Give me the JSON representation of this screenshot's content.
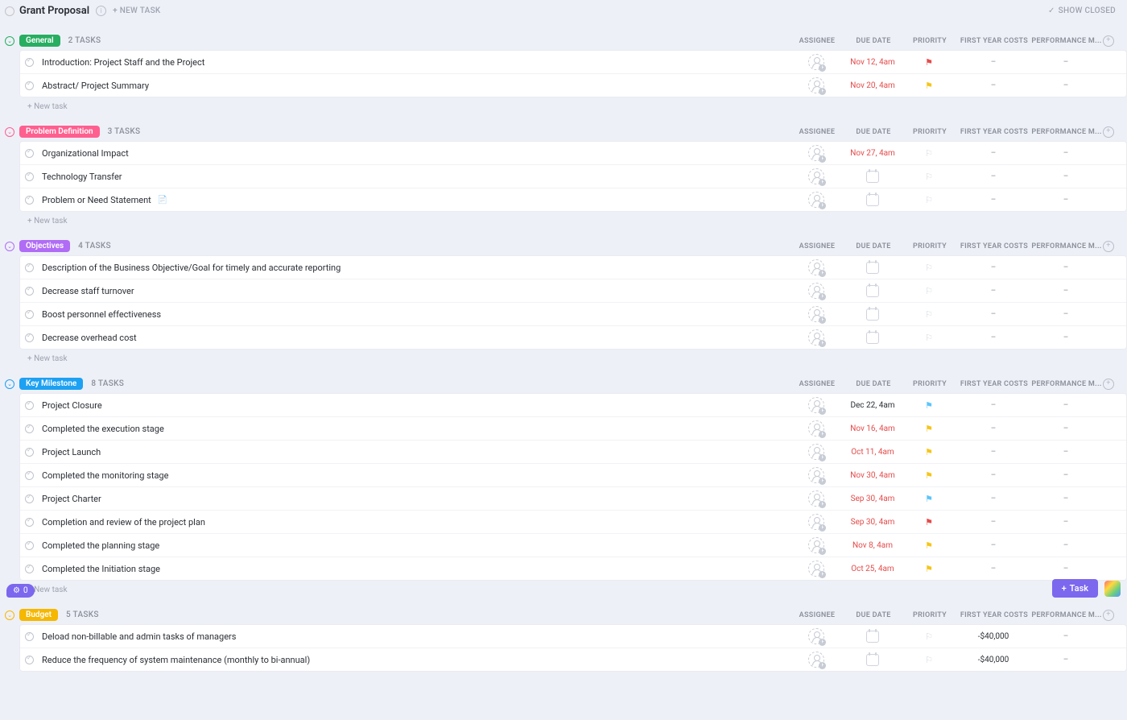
{
  "header": {
    "title": "Grant Proposal",
    "new_task": "+ NEW TASK",
    "show_closed": "SHOW CLOSED"
  },
  "columns": {
    "assignee": "ASSIGNEE",
    "due": "DUE DATE",
    "priority": "PRIORITY",
    "cost": "FIRST YEAR COSTS",
    "perf": "PERFORMANCE M..."
  },
  "new_task_label": "+ New task",
  "sections": [
    {
      "name": "General",
      "color": "#27ae60",
      "count": "2 TASKS",
      "tasks": [
        {
          "name": "Introduction: Project Staff and the Project",
          "due": "Nov 12, 4am",
          "due_style": "red",
          "flag": "red",
          "cost": "–",
          "perf": "–"
        },
        {
          "name": "Abstract/ Project Summary",
          "due": "Nov 20, 4am",
          "due_style": "red",
          "flag": "yellow",
          "cost": "–",
          "perf": "–"
        }
      ],
      "show_new": true
    },
    {
      "name": "Problem Definition",
      "color": "#ff5f8f",
      "count": "3 TASKS",
      "tasks": [
        {
          "name": "Organizational Impact",
          "due": "Nov 27, 4am",
          "due_style": "red",
          "flag": "ghost",
          "cost": "–",
          "perf": "–"
        },
        {
          "name": "Technology Transfer",
          "due": "",
          "due_style": "cal",
          "flag": "ghost",
          "cost": "–",
          "perf": "–"
        },
        {
          "name": "Problem or Need Statement",
          "doc": true,
          "due": "",
          "due_style": "cal",
          "flag": "ghost",
          "cost": "–",
          "perf": "–"
        }
      ],
      "show_new": true
    },
    {
      "name": "Objectives",
      "color": "#b06cf5",
      "count": "4 TASKS",
      "tasks": [
        {
          "name": "Description of the Business Objective/Goal for timely and accurate reporting",
          "due": "",
          "due_style": "cal",
          "flag": "ghost",
          "cost": "–",
          "perf": "–"
        },
        {
          "name": "Decrease staff turnover",
          "due": "",
          "due_style": "cal",
          "flag": "ghost",
          "cost": "–",
          "perf": "–"
        },
        {
          "name": "Boost personnel effectiveness",
          "due": "",
          "due_style": "cal",
          "flag": "ghost",
          "cost": "–",
          "perf": "–"
        },
        {
          "name": "Decrease overhead cost",
          "due": "",
          "due_style": "cal",
          "flag": "ghost",
          "cost": "–",
          "perf": "–"
        }
      ],
      "show_new": true
    },
    {
      "name": "Key Milestone",
      "color": "#1da1f2",
      "count": "8 TASKS",
      "tasks": [
        {
          "name": "Project Closure",
          "due": "Dec 22, 4am",
          "due_style": "dark",
          "flag": "blue",
          "cost": "–",
          "perf": "–"
        },
        {
          "name": "Completed the execution stage",
          "due": "Nov 16, 4am",
          "due_style": "red",
          "flag": "yellow",
          "cost": "–",
          "perf": "–"
        },
        {
          "name": "Project Launch",
          "due": "Oct 11, 4am",
          "due_style": "red",
          "flag": "yellow",
          "cost": "–",
          "perf": "–"
        },
        {
          "name": "Completed the monitoring stage",
          "due": "Nov 30, 4am",
          "due_style": "red",
          "flag": "yellow",
          "cost": "–",
          "perf": "–"
        },
        {
          "name": "Project Charter",
          "due": "Sep 30, 4am",
          "due_style": "red",
          "flag": "blue",
          "cost": "–",
          "perf": "–"
        },
        {
          "name": "Completion and review of the project plan",
          "due": "Sep 30, 4am",
          "due_style": "red",
          "flag": "red",
          "cost": "–",
          "perf": "–"
        },
        {
          "name": "Completed the planning stage",
          "due": "Nov 8, 4am",
          "due_style": "red",
          "flag": "yellow",
          "cost": "–",
          "perf": "–"
        },
        {
          "name": "Completed the Initiation stage",
          "due": "Oct 25, 4am",
          "due_style": "red",
          "flag": "yellow",
          "cost": "–",
          "perf": "–"
        }
      ],
      "show_new": true
    },
    {
      "name": "Budget",
      "color": "#f5b700",
      "count": "5 TASKS",
      "tasks": [
        {
          "name": "Deload non-billable and admin tasks of managers",
          "due": "",
          "due_style": "cal",
          "flag": "ghost",
          "cost": "-$40,000",
          "perf": "–"
        },
        {
          "name": "Reduce the frequency of system maintenance (monthly to bi-annual)",
          "due": "",
          "due_style": "cal",
          "flag": "ghost",
          "cost": "-$40,000",
          "perf": "–"
        }
      ],
      "show_new": false
    }
  ],
  "task_button": "Task",
  "badge_count": "0"
}
